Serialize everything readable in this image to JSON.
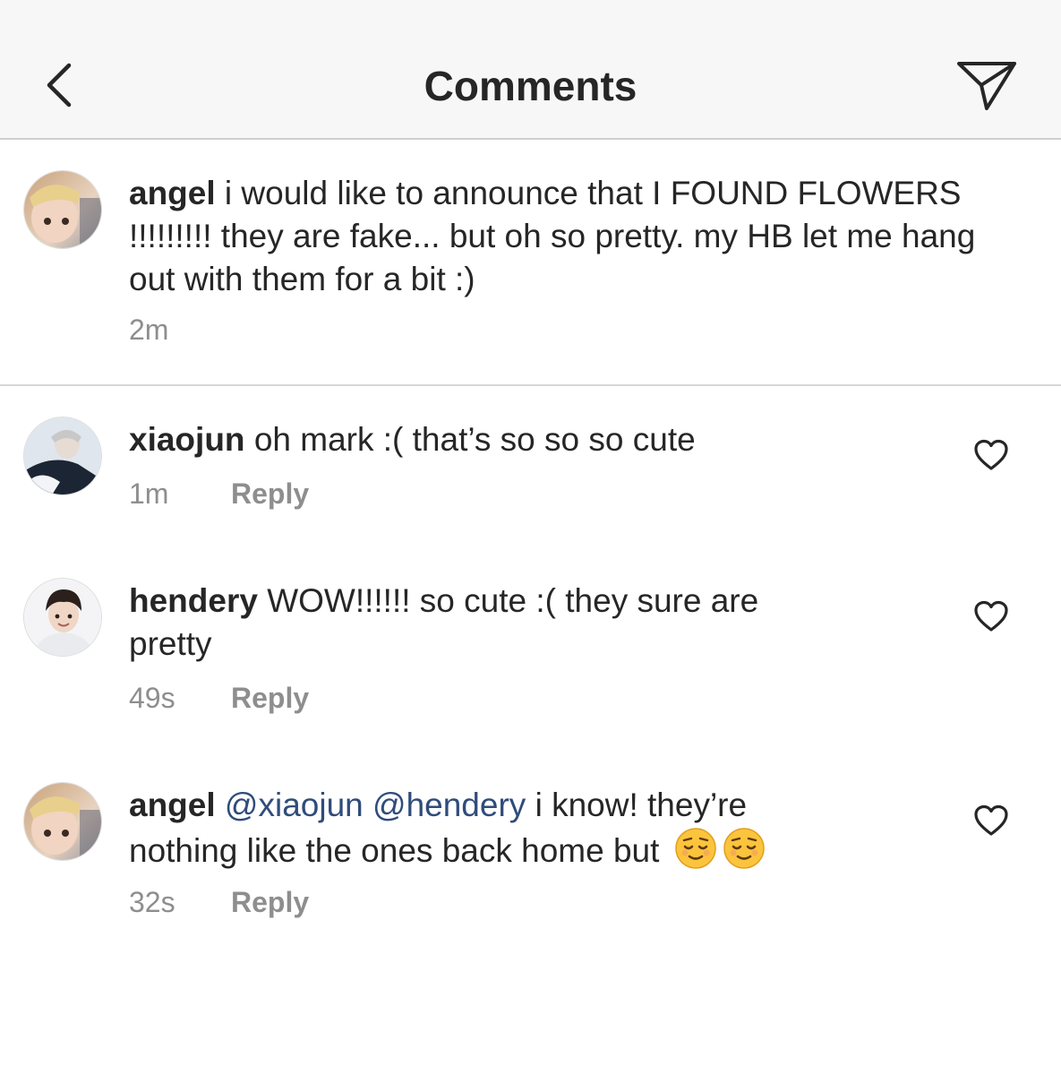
{
  "header": {
    "title": "Comments",
    "back_icon": "chevron-left-icon",
    "share_icon": "paper-plane-icon"
  },
  "caption": {
    "username": "angel",
    "text": "i would like to announce that I FOUND FLOWERS !!!!!!!!! they are fake... but oh so pretty. my HB let me hang out with them for a bit :)",
    "time": "2m"
  },
  "comments": [
    {
      "username": "xiaojun",
      "text": "oh mark :( that’s so so so cute",
      "time": "1m",
      "reply_label": "Reply"
    },
    {
      "username": "hendery",
      "text": "WOW!!!!!! so cute :( they sure are pretty",
      "time": "49s",
      "reply_label": "Reply"
    },
    {
      "username": "angel",
      "mentions": [
        "@xiaojun",
        "@hendery"
      ],
      "text": "i know! they’re nothing like the ones back home but",
      "emoji": [
        "relieved-face-emoji",
        "relieved-face-emoji"
      ],
      "time": "32s",
      "reply_label": "Reply"
    }
  ],
  "colors": {
    "header_bg": "#f7f7f7",
    "text": "#262626",
    "secondary": "#8e8e8e",
    "mention": "#2f4c7a",
    "divider": "#d6d6d6"
  }
}
